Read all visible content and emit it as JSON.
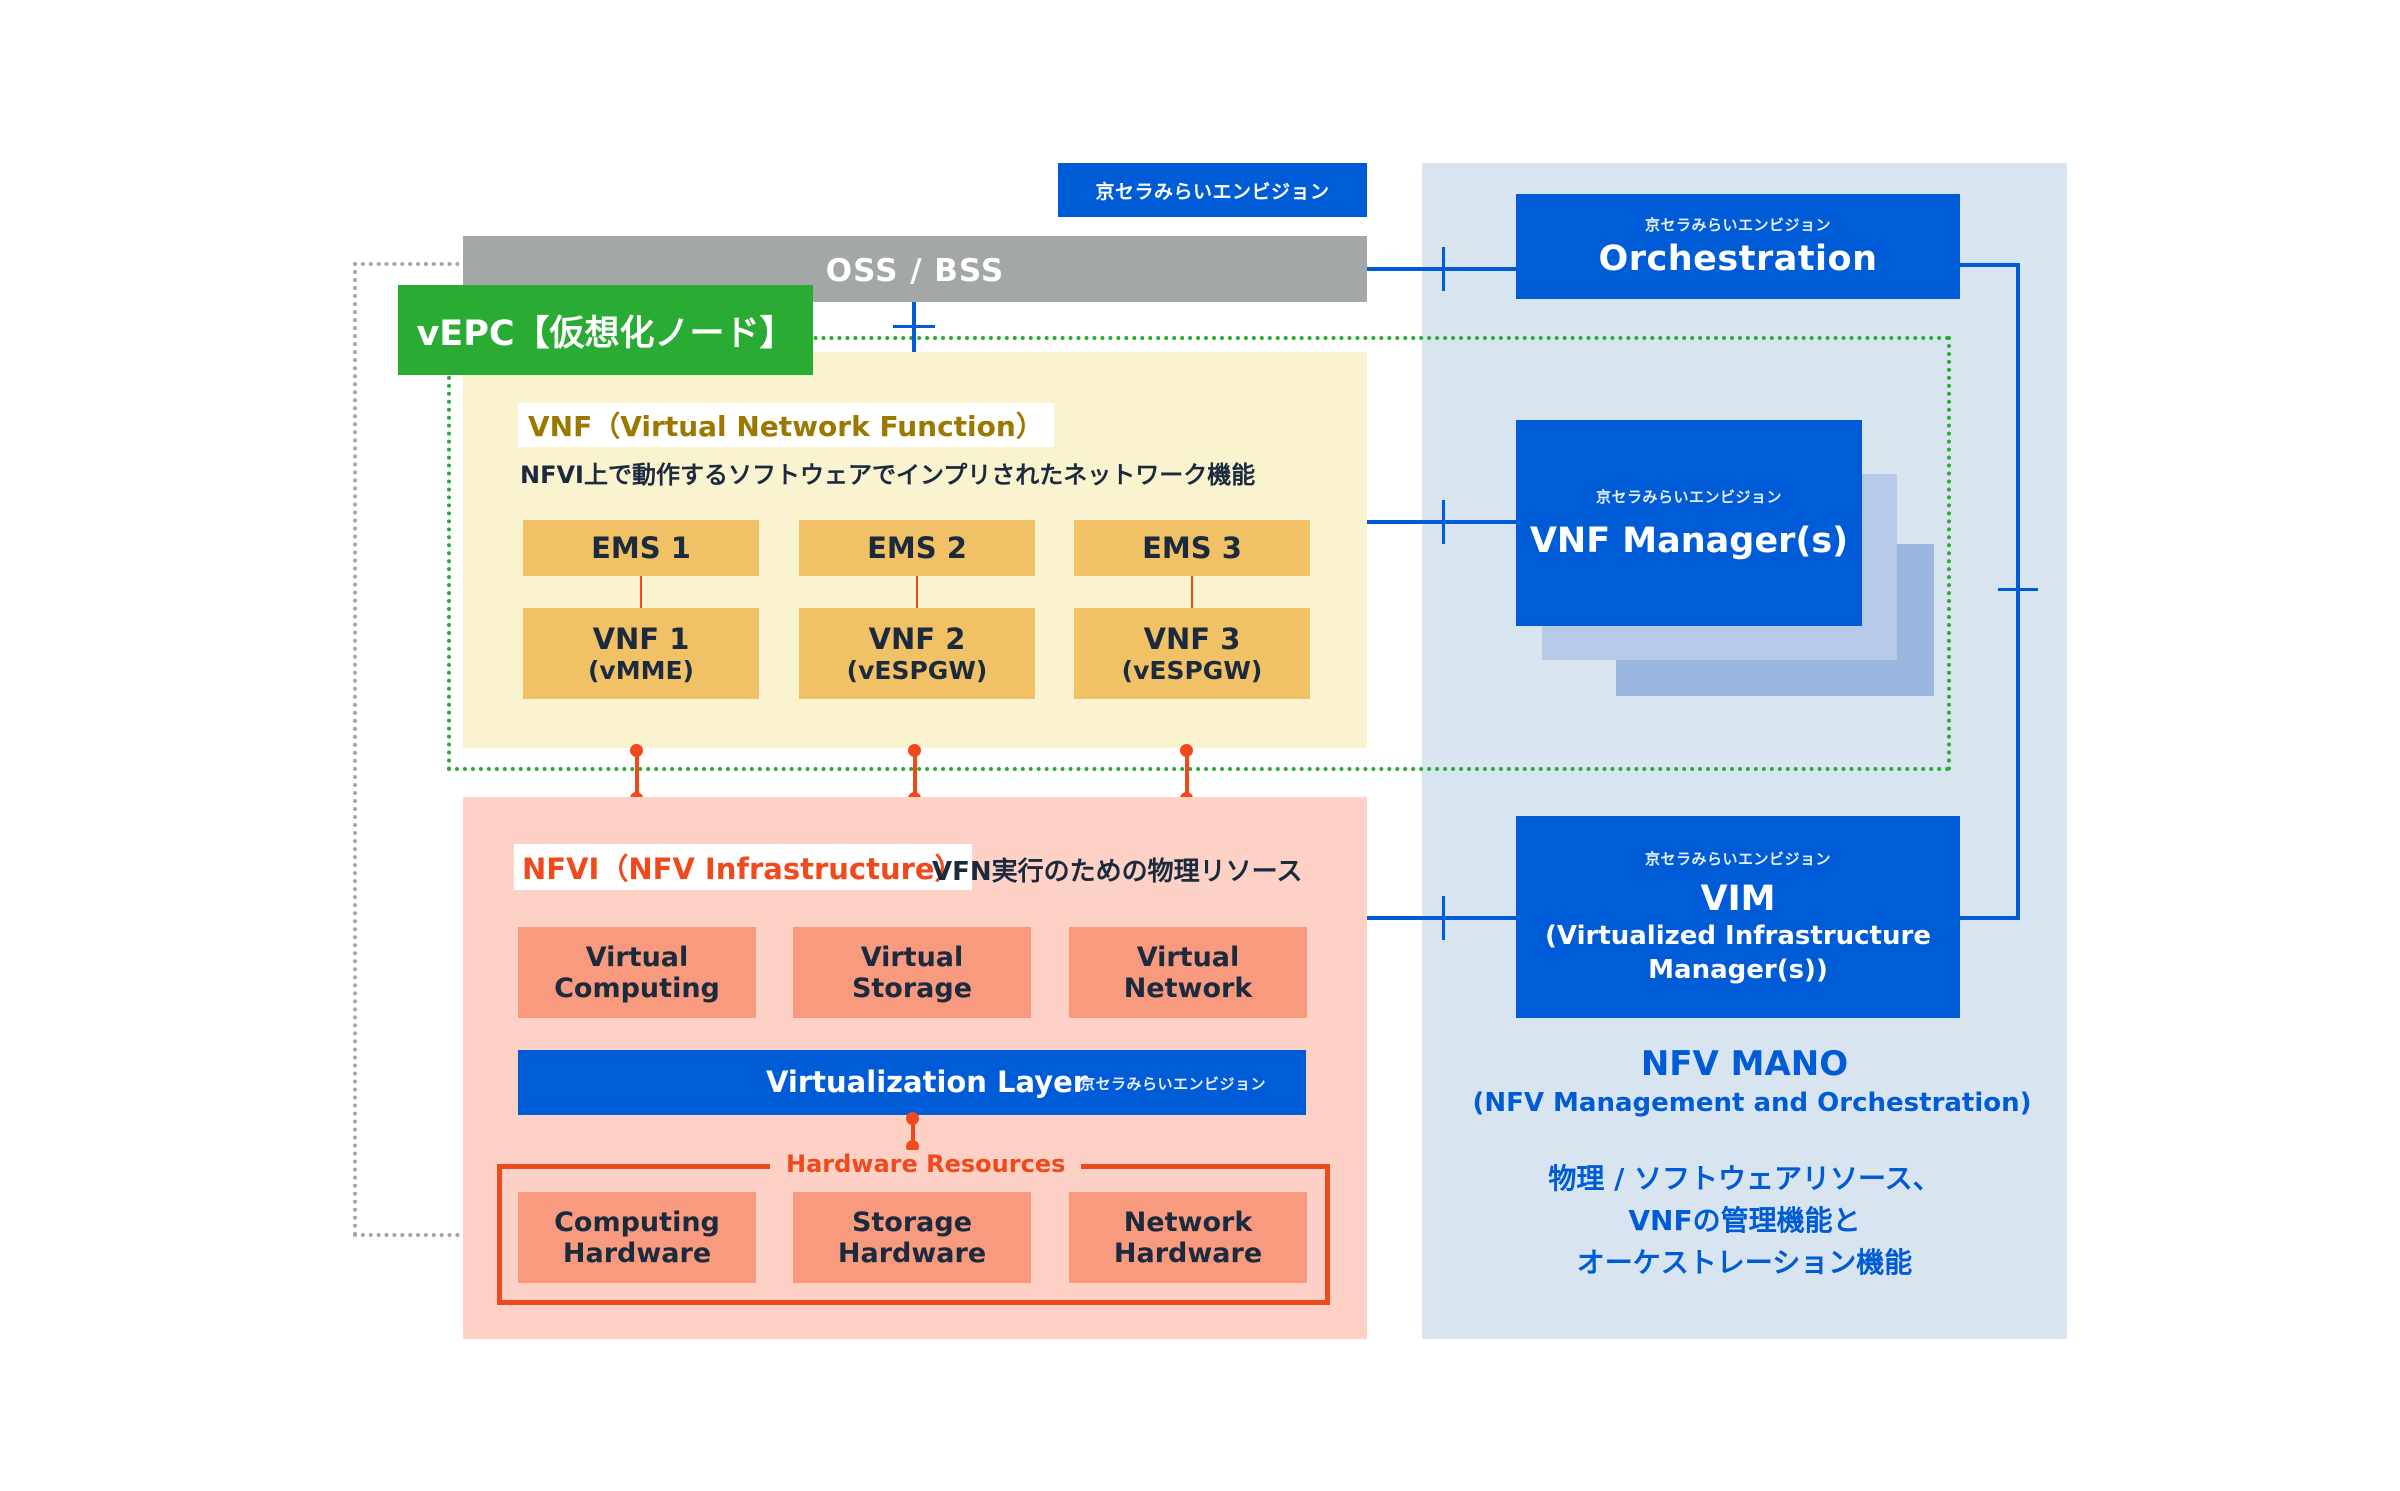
{
  "brand_tag": "京セラみらいエンビジョン",
  "oss_bss": {
    "label": "OSS / BSS"
  },
  "vepc": {
    "label": "vEPC【仮想化ノード】"
  },
  "vnf_section": {
    "title": "VNF（Virtual Network Function）",
    "subtitle": "NFVI上で動作するソフトウェアでインプリされたネットワーク機能",
    "ems": [
      "EMS 1",
      "EMS 2",
      "EMS 3"
    ],
    "vnfs": [
      {
        "name": "VNF 1",
        "type": "(vMME)"
      },
      {
        "name": "VNF 2",
        "type": "(vESPGW)"
      },
      {
        "name": "VNF 3",
        "type": "(vESPGW)"
      }
    ]
  },
  "nfvi_section": {
    "title": "NFVI（NFV Infrastructure）",
    "subtitle": "VFN実行のための物理リソース",
    "virtual_resources": [
      {
        "line1": "Virtual",
        "line2": "Computing"
      },
      {
        "line1": "Virtual",
        "line2": "Storage"
      },
      {
        "line1": "Virtual",
        "line2": "Network"
      }
    ],
    "virtualization_layer": {
      "label": "Virtualization Layer",
      "brand": "京セラみらいエンビジョン"
    },
    "hardware": {
      "label": "Hardware Resources",
      "items": [
        {
          "line1": "Computing",
          "line2": "Hardware"
        },
        {
          "line1": "Storage",
          "line2": "Hardware"
        },
        {
          "line1": "Network",
          "line2": "Hardware"
        }
      ]
    }
  },
  "mano": {
    "orchestration": {
      "brand": "京セラみらいエンビジョン",
      "label": "Orchestration"
    },
    "vnf_manager": {
      "brand": "京セラみらいエンビジョン",
      "label": "VNF Manager(s)"
    },
    "vim": {
      "brand": "京セラみらいエンビジョン",
      "label": "VIM",
      "line2": "(Virtualized Infrastructure",
      "line3": "Manager(s))"
    },
    "title": "NFV MANO",
    "subtitle": "(NFV Management and Orchestration)",
    "description": [
      "物理 / ソフトウェアリソース、",
      "VNFの管理機能と",
      "オーケストレーション機能"
    ]
  },
  "colors": {
    "brand_blue": "#005bd6",
    "vepc_green": "#2aab34",
    "nfvi_orange": "#f04a1c",
    "ems_yellow": "#f1c166",
    "oss_gray": "#a3a7a7"
  }
}
